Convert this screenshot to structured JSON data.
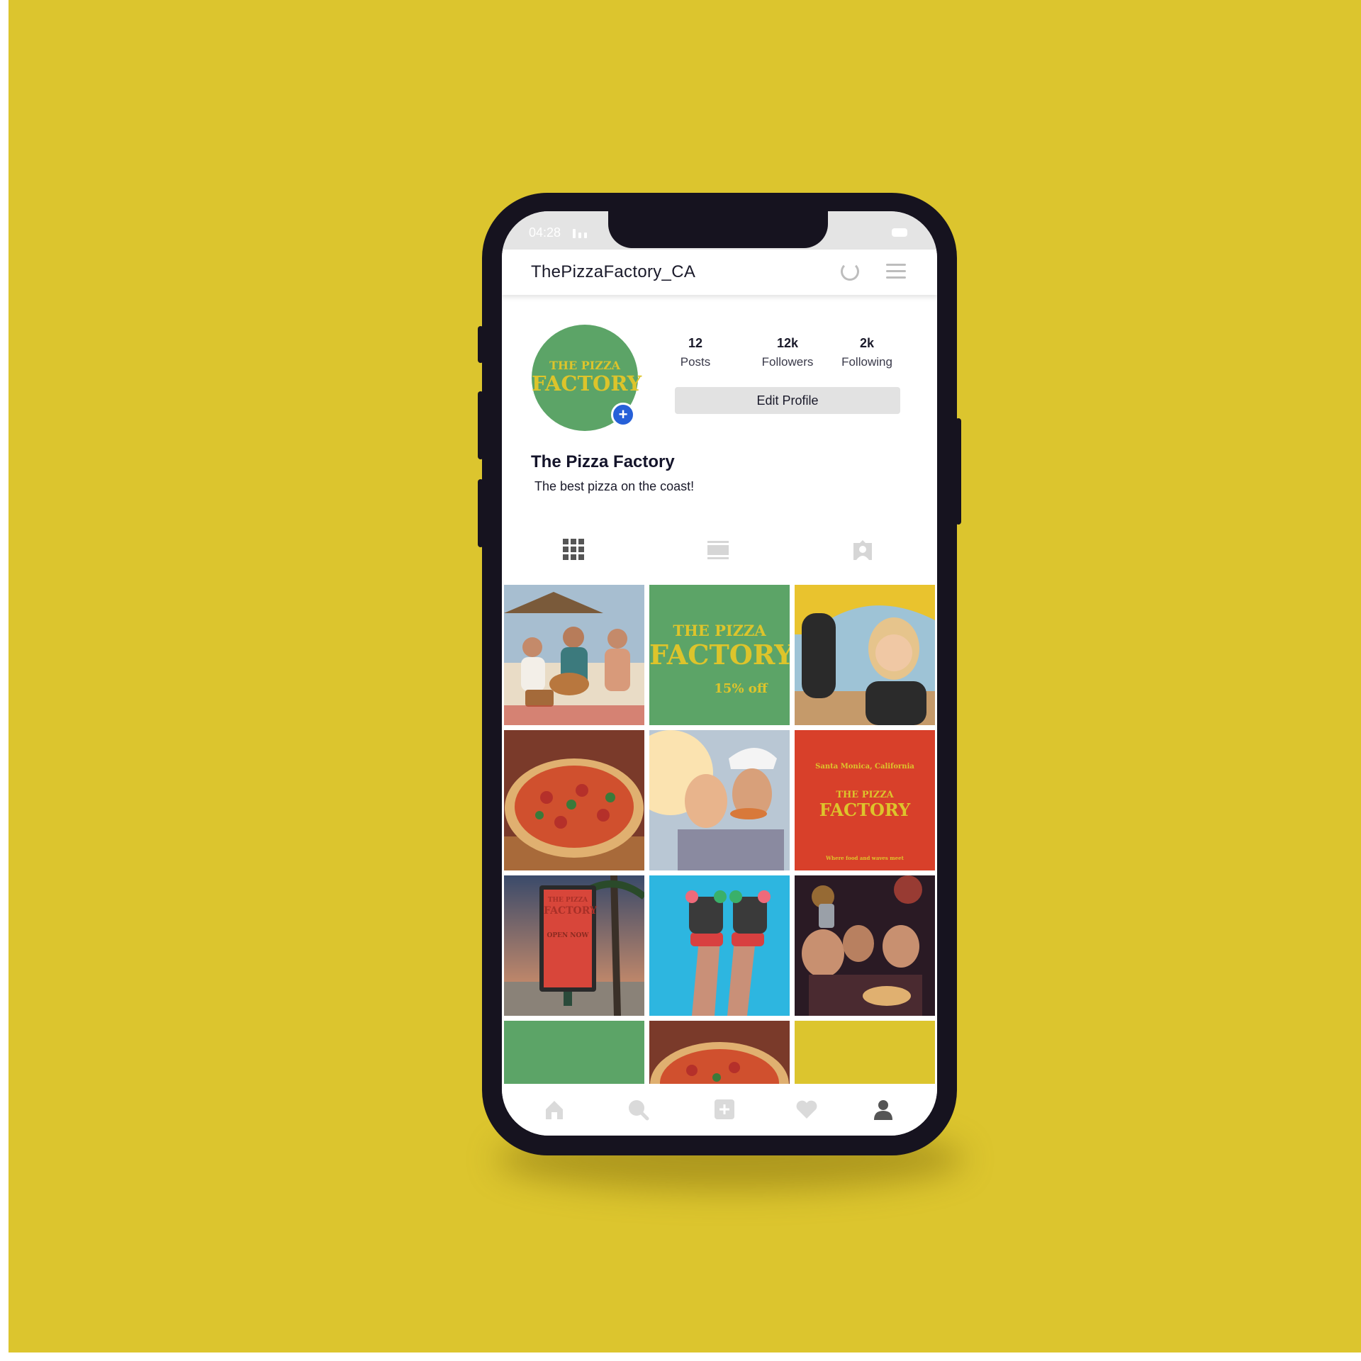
{
  "colors": {
    "background": "#dcc52e",
    "brand_green": "#5ca467",
    "brand_yellow": "#ddc42b",
    "brand_red": "#d8402a",
    "badge_blue": "#2660d8"
  },
  "status_bar": {
    "time": "04:28",
    "icons": [
      "signal-icon",
      "battery-icon"
    ]
  },
  "header": {
    "username": "ThePizzaFactory_CA",
    "icons": [
      "refresh-icon",
      "menu-icon"
    ]
  },
  "profile": {
    "avatar": {
      "line1": "THE PIZZA",
      "line2": "FACTORY",
      "badge": "+"
    },
    "stats": [
      {
        "value": "12",
        "label": "Posts"
      },
      {
        "value": "12k",
        "label": "Followers"
      },
      {
        "value": "2k",
        "label": "Following"
      }
    ],
    "edit_button": "Edit Profile",
    "display_name": "The Pizza Factory",
    "bio": "The best pizza on the coast!"
  },
  "tabs": [
    {
      "icon": "grid-icon",
      "active": true
    },
    {
      "icon": "feed-icon",
      "active": false
    },
    {
      "icon": "tagged-icon",
      "active": false
    }
  ],
  "posts": [
    {
      "content": "friends picnic on beach with guitar and pizza"
    },
    {
      "content": "brand graphic",
      "line1": "THE PIZZA",
      "line2": "FACTORY",
      "line3": "15% off"
    },
    {
      "content": "woman smiling under surfboard"
    },
    {
      "content": "pizza on wooden board"
    },
    {
      "content": "couple eating pizza at sunset"
    },
    {
      "content": "brand graphic",
      "line0": "Santa Monica, California",
      "line1": "THE PIZZA",
      "line2": "FACTORY",
      "line3": "Where food and waves meet"
    },
    {
      "content": "billboard poster on boardwalk",
      "line1": "THE PIZZA",
      "line2": "FACTORY",
      "line3": "OPEN NOW"
    },
    {
      "content": "legs in roller skates against blue sky"
    },
    {
      "content": "friends taking selfie with pizza at night"
    },
    {
      "content": "solid green tile"
    },
    {
      "content": "pizza on wooden board"
    },
    {
      "content": "solid yellow tile"
    }
  ],
  "bottom_nav": [
    {
      "icon": "home-icon",
      "active": false
    },
    {
      "icon": "search-icon",
      "active": false
    },
    {
      "icon": "add-post-icon",
      "active": false
    },
    {
      "icon": "heart-icon",
      "active": false
    },
    {
      "icon": "profile-icon",
      "active": true
    }
  ]
}
